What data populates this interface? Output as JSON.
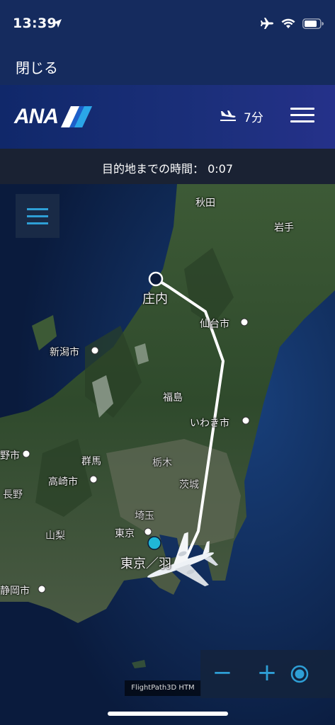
{
  "status_bar": {
    "time": "13:39",
    "location_icon": "location-arrow-icon",
    "icons": [
      "airplane-mode-icon",
      "wifi-icon",
      "battery-icon"
    ]
  },
  "nav": {
    "close_label": "閉じる"
  },
  "header": {
    "logo_text": "ANA",
    "eta_icon": "landing-plane-icon",
    "eta_text": "7分",
    "menu_icon": "hamburger-menu-icon"
  },
  "flight_info": {
    "time_to_destination": "目的地までの時間： 0:07"
  },
  "map": {
    "layers_icon": "layers-menu-icon",
    "origin_label": "庄内",
    "destination_label": "東京／羽",
    "labels": {
      "akita": "秋田",
      "iwate": "岩手",
      "sendai": "仙台市",
      "niigata": "新潟市",
      "fukushima": "福島",
      "iwaki": "いわき市",
      "gunma": "群馬",
      "tochigi": "栃木",
      "takasaki": "高崎市",
      "ibaraki": "茨城",
      "nagano": "長野",
      "saitama": "埼玉",
      "tokyo": "東京",
      "yamanashi": "山梨",
      "shizuoka": "静岡市",
      "partial_left": "野市"
    },
    "attribution": "FlightPath3D HTM",
    "controls": {
      "zoom_out": "−",
      "zoom_in": "+",
      "center_icon": "recenter-target-icon"
    }
  },
  "colors": {
    "accent": "#2e9fd6",
    "header_bg": "#1b2f7a",
    "status_bg": "#152b5e",
    "route": "#ffffff"
  }
}
